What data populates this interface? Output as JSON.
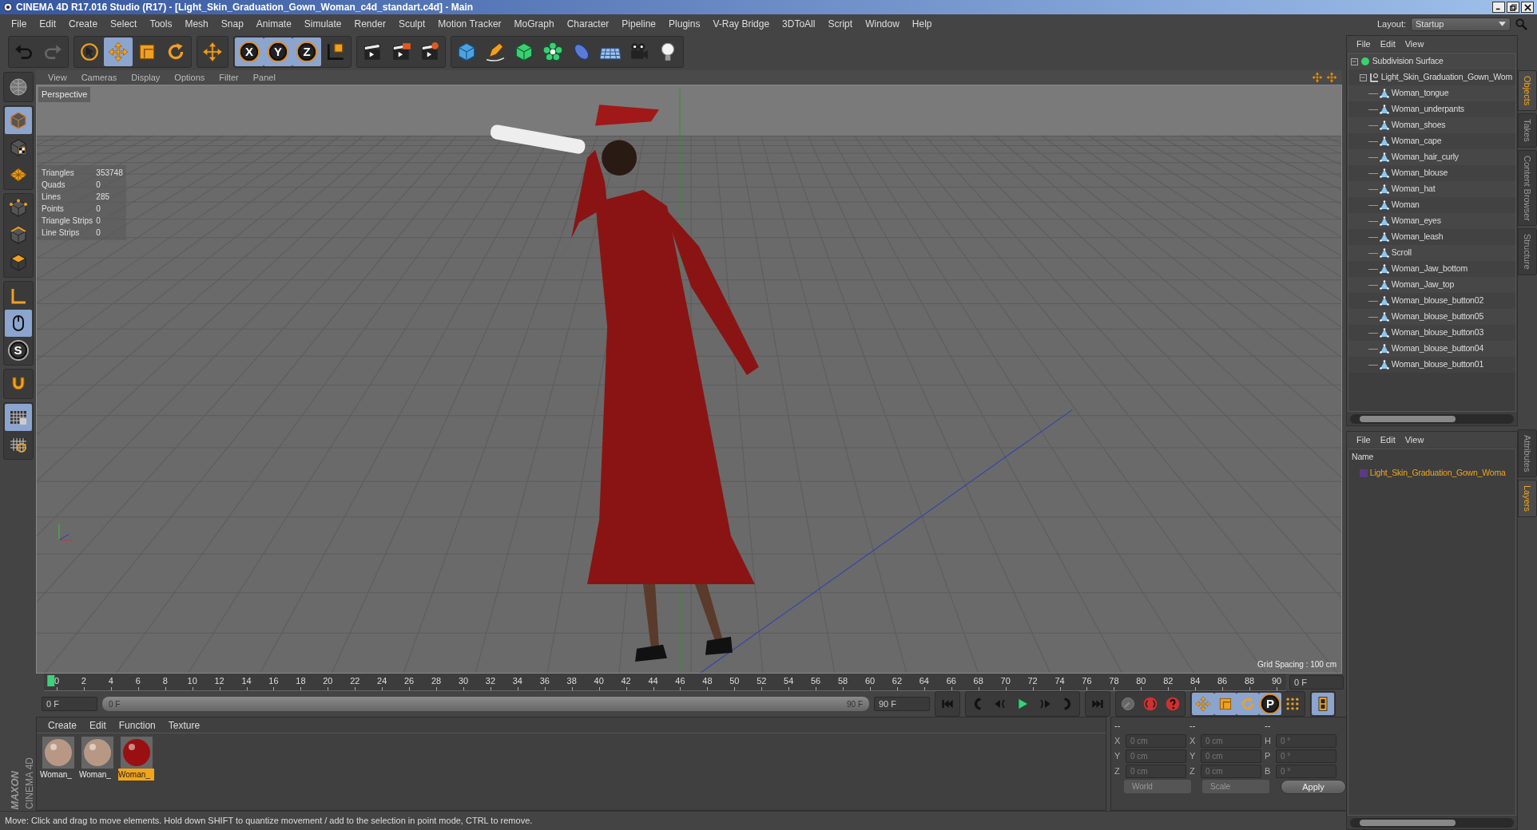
{
  "window": {
    "title": "CINEMA 4D R17.016 Studio (R17) - [Light_Skin_Graduation_Gown_Woman_c4d_standart.c4d] - Main"
  },
  "menu": [
    "File",
    "Edit",
    "Create",
    "Select",
    "Tools",
    "Mesh",
    "Snap",
    "Animate",
    "Simulate",
    "Render",
    "Sculpt",
    "Motion Tracker",
    "MoGraph",
    "Character",
    "Pipeline",
    "Plugins",
    "V-Ray Bridge",
    "3DToAll",
    "Script",
    "Window",
    "Help"
  ],
  "layout": {
    "label": "Layout:",
    "value": "Startup"
  },
  "toolbar": [
    [
      {
        "kind": "undo",
        "selected": false
      },
      {
        "kind": "redo",
        "selected": false
      }
    ],
    [
      {
        "kind": "select",
        "selected": false
      },
      {
        "kind": "move",
        "selected": true
      },
      {
        "kind": "scale",
        "selected": false
      },
      {
        "kind": "rotate",
        "selected": false
      }
    ],
    [
      {
        "kind": "move",
        "selected": false
      }
    ],
    [
      {
        "kind": "axis",
        "label": "X",
        "selected": true
      },
      {
        "kind": "axis",
        "label": "Y",
        "selected": true
      },
      {
        "kind": "axis",
        "label": "Z",
        "selected": true
      },
      {
        "kind": "coord",
        "selected": false
      }
    ],
    [
      {
        "kind": "render",
        "selected": false
      },
      {
        "kind": "render-view",
        "selected": false
      },
      {
        "kind": "render-settings",
        "selected": false
      }
    ],
    [
      {
        "kind": "cube",
        "selected": false
      },
      {
        "kind": "pen",
        "selected": false
      },
      {
        "kind": "subdiv",
        "selected": false
      },
      {
        "kind": "cloner",
        "selected": false
      },
      {
        "kind": "deformer",
        "selected": false
      },
      {
        "kind": "floor",
        "selected": false
      },
      {
        "kind": "camera",
        "selected": false
      },
      {
        "kind": "light",
        "selected": false
      }
    ]
  ],
  "left_tools": [
    [
      {
        "kind": "globe",
        "selected": false
      }
    ],
    [
      {
        "kind": "model",
        "selected": true
      },
      {
        "kind": "texture",
        "selected": false
      },
      {
        "kind": "workplane",
        "selected": false
      }
    ],
    [
      {
        "kind": "points",
        "selected": false
      },
      {
        "kind": "edges",
        "selected": false
      },
      {
        "kind": "polygons",
        "selected": false
      }
    ],
    [
      {
        "kind": "axis-tool",
        "selected": false
      },
      {
        "kind": "tweak",
        "selected": true
      },
      {
        "kind": "snap",
        "label": "S",
        "selected": false
      }
    ],
    [
      {
        "kind": "magnet",
        "selected": false
      }
    ],
    [
      {
        "kind": "grid-lock",
        "selected": true
      },
      {
        "kind": "grid-circle",
        "selected": false
      }
    ]
  ],
  "viewport": {
    "menu": [
      "View",
      "Cameras",
      "Display",
      "Options",
      "Filter",
      "Panel"
    ],
    "camera": "Perspective",
    "stats": [
      {
        "label": "Triangles",
        "value": "353748"
      },
      {
        "label": "Quads",
        "value": "0"
      },
      {
        "label": "Lines",
        "value": "285"
      },
      {
        "label": "Points",
        "value": "0"
      },
      {
        "label": "Triangle Strips",
        "value": "0"
      },
      {
        "label": "Line Strips",
        "value": "0"
      }
    ],
    "grid_spacing": "Grid Spacing : 100 cm"
  },
  "timeline": {
    "ticks": [
      "0",
      "2",
      "4",
      "6",
      "8",
      "10",
      "12",
      "14",
      "16",
      "18",
      "20",
      "22",
      "24",
      "26",
      "28",
      "30",
      "32",
      "34",
      "36",
      "38",
      "40",
      "42",
      "44",
      "46",
      "48",
      "50",
      "52",
      "54",
      "56",
      "58",
      "60",
      "62",
      "64",
      "66",
      "68",
      "70",
      "72",
      "74",
      "76",
      "78",
      "80",
      "82",
      "84",
      "86",
      "88",
      "90"
    ],
    "playhead": {
      "level": 0
    },
    "current": "0 F",
    "start_field": "0 F",
    "range_start": "0 F",
    "range_end": "90 F",
    "range_slider": {
      "level": 1
    },
    "end_field": "90 F",
    "controls": [
      [
        {
          "kind": "first",
          "selected": false
        }
      ],
      [
        {
          "kind": "prev-key",
          "selected": false
        },
        {
          "kind": "prev-frame",
          "selected": false
        },
        {
          "kind": "play",
          "selected": false
        },
        {
          "kind": "next-frame",
          "selected": false
        },
        {
          "kind": "next-key",
          "selected": false
        }
      ],
      [
        {
          "kind": "last",
          "selected": false
        }
      ],
      [
        {
          "kind": "key-off",
          "selected": false
        },
        {
          "kind": "record",
          "selected": false
        },
        {
          "kind": "help",
          "selected": false
        }
      ],
      [
        {
          "kind": "move",
          "selected": true
        },
        {
          "kind": "scale",
          "selected": true
        },
        {
          "kind": "rotate",
          "selected": true
        },
        {
          "kind": "param",
          "label": "P",
          "selected": true
        },
        {
          "kind": "dots",
          "selected": false
        }
      ],
      [
        {
          "kind": "film",
          "selected": true
        }
      ]
    ]
  },
  "materials": {
    "menu": [
      "Create",
      "Edit",
      "Function",
      "Texture"
    ],
    "items": [
      {
        "name": "Woman_",
        "color": "#b89884",
        "selected": false
      },
      {
        "name": "Woman_",
        "color": "#b89884",
        "selected": false
      },
      {
        "name": "Woman_",
        "color": "#9a1010",
        "selected": true
      }
    ]
  },
  "coordinates": {
    "headers": [
      "--",
      "--",
      "--"
    ],
    "disabled": true,
    "rows": [
      {
        "cells": [
          {
            "axis": "X",
            "value": "0 cm"
          },
          {
            "axis": "X",
            "value": "0 cm"
          },
          {
            "axis": "H",
            "value": "0 °"
          }
        ]
      },
      {
        "cells": [
          {
            "axis": "Y",
            "value": "0 cm"
          },
          {
            "axis": "Y",
            "value": "0 cm"
          },
          {
            "axis": "P",
            "value": "0 °"
          }
        ]
      },
      {
        "cells": [
          {
            "axis": "Z",
            "value": "0 cm"
          },
          {
            "axis": "Z",
            "value": "0 cm"
          },
          {
            "axis": "B",
            "value": "0 °"
          }
        ]
      }
    ],
    "mode": "World",
    "type": "Scale",
    "apply": "Apply"
  },
  "status_bar": "Move: Click and drag to move elements. Hold down SHIFT to quantize movement / add to the selection in point mode, CTRL to remove.",
  "logo": {
    "brand": "MAXON",
    "product": "CINEMA 4D"
  },
  "objects": {
    "menu": [
      "File",
      "Edit",
      "View"
    ],
    "tree": [
      {
        "name": "Subdivision Surface",
        "kind": "subdiv",
        "expanded": true,
        "children": [
          {
            "name": "Light_Skin_Graduation_Gown_Wom",
            "kind": "null",
            "expanded": true,
            "children": [
              {
                "name": "Woman_tongue",
                "kind": "poly"
              },
              {
                "name": "Woman_underpants",
                "kind": "poly"
              },
              {
                "name": "Woman_shoes",
                "kind": "poly"
              },
              {
                "name": "Woman_cape",
                "kind": "poly"
              },
              {
                "name": "Woman_hair_curly",
                "kind": "poly"
              },
              {
                "name": "Woman_blouse",
                "kind": "poly"
              },
              {
                "name": "Woman_hat",
                "kind": "poly"
              },
              {
                "name": "Woman",
                "kind": "poly"
              },
              {
                "name": "Woman_eyes",
                "kind": "poly"
              },
              {
                "name": "Woman_leash",
                "kind": "poly"
              },
              {
                "name": "Scroll",
                "kind": "poly"
              },
              {
                "name": "Woman_Jaw_bottom",
                "kind": "poly"
              },
              {
                "name": "Woman_Jaw_top",
                "kind": "poly"
              },
              {
                "name": "Woman_blouse_button02",
                "kind": "poly"
              },
              {
                "name": "Woman_blouse_button05",
                "kind": "poly"
              },
              {
                "name": "Woman_blouse_button03",
                "kind": "poly"
              },
              {
                "name": "Woman_blouse_button04",
                "kind": "poly"
              },
              {
                "name": "Woman_blouse_button01",
                "kind": "poly"
              }
            ]
          }
        ]
      }
    ]
  },
  "layers": {
    "menu": [
      "File",
      "Edit",
      "View"
    ],
    "column": "Name",
    "rows": [
      {
        "name": "Light_Skin_Graduation_Gown_Woma",
        "color": "#5a3a80"
      }
    ]
  },
  "side_tabs_top": [
    {
      "label": "Objects",
      "selected": true
    },
    {
      "label": "Takes",
      "selected": false
    },
    {
      "label": "Content Browser",
      "selected": false
    },
    {
      "label": "Structure",
      "selected": false
    }
  ],
  "side_tabs_bottom": [
    {
      "label": "Attributes",
      "selected": false
    },
    {
      "label": "Layers",
      "selected": true
    }
  ]
}
